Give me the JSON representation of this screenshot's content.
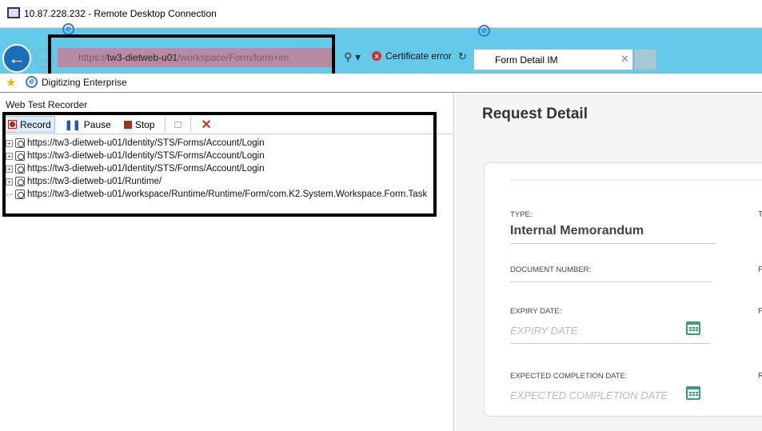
{
  "window": {
    "title": "10.87.228.232 - Remote Desktop Connection"
  },
  "browser": {
    "address": {
      "prefix": "https://",
      "host": "tw3-dietweb-u01",
      "path": "/workspace/Form/form+im"
    },
    "certificate_error": "Certificate error",
    "tab": {
      "title": "Form Detail IM"
    },
    "favorites": [
      {
        "label": "Digitizing Enterprise"
      }
    ]
  },
  "recorder": {
    "title": "Web Test Recorder",
    "toolbar": {
      "record": "Record",
      "pause": "Pause",
      "stop": "Stop"
    },
    "requests": [
      {
        "url": "https://tw3-dietweb-u01/Identity/STS/Forms/Account/Login",
        "expandable": true
      },
      {
        "url": "https://tw3-dietweb-u01/Identity/STS/Forms/Account/Login",
        "expandable": true
      },
      {
        "url": "https://tw3-dietweb-u01/Identity/STS/Forms/Account/Login",
        "expandable": true
      },
      {
        "url": "https://tw3-dietweb-u01/Runtime/",
        "expandable": true
      },
      {
        "url": "https://tw3-dietweb-u01/workspace/Runtime/Runtime/Form/com.K2.System.Workspace.Form.Task",
        "expandable": false
      }
    ]
  },
  "form": {
    "title": "Request Detail",
    "type_label": "TYPE:",
    "type_value": "Internal Memorandum",
    "docnum_label": "DOCUMENT NUMBER:",
    "expiry_label": "EXPIRY DATE:",
    "expiry_placeholder": "EXPIRY DATE",
    "completion_label": "EXPECTED COMPLETION DATE:",
    "completion_placeholder": "EXPECTED COMPLETION DATE",
    "right_col_cut": [
      "T",
      "F",
      "P",
      "R"
    ]
  },
  "colors": {
    "chrome": "#65c9ea",
    "address_bg": "#b88aa4",
    "calendar": "#3a9a7a"
  }
}
